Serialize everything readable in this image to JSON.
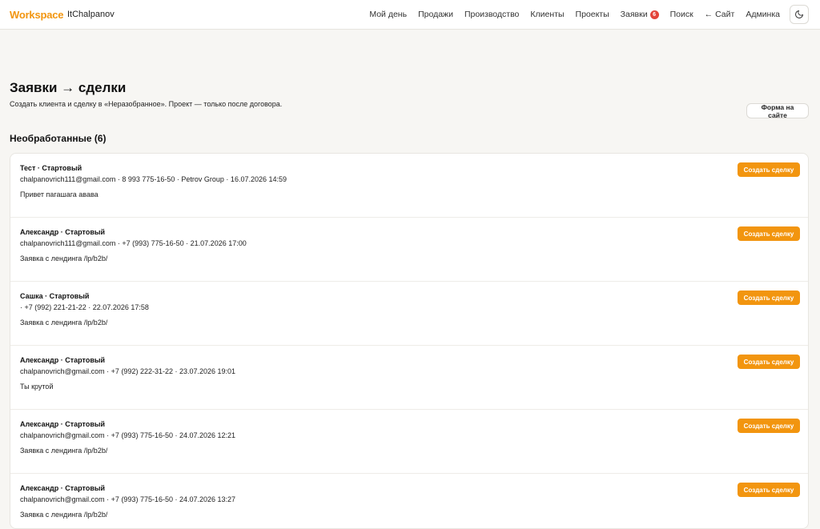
{
  "header": {
    "brand": "Workspace",
    "user": "ItChalpanov",
    "nav": [
      {
        "label": "Мой день"
      },
      {
        "label": "Продажи"
      },
      {
        "label": "Производство"
      },
      {
        "label": "Клиенты"
      },
      {
        "label": "Проекты"
      },
      {
        "label": "Заявки",
        "badge": "6"
      },
      {
        "label": "Поиск"
      },
      {
        "label": "← Сайт"
      },
      {
        "label": "Админка"
      }
    ],
    "theme_icon": "moon-icon"
  },
  "page": {
    "title": "Заявки → сделки",
    "subtitle": "Создать клиента и сделку в «Неразобранное». Проект — только после договора.",
    "form_button": "Форма на сайте",
    "section_title": "Необработанные (6)"
  },
  "requests": [
    {
      "title": "Тест · Стартовый",
      "meta": "chalpanovrich111@gmail.com · 8 993 775-16-50 · Petrov Group · 16.07.2026 14:59",
      "message": "Привет пагашага авава",
      "button": "Создать сделку"
    },
    {
      "title": "Александр · Стартовый",
      "meta": "chalpanovrich111@gmail.com · +7 (993) 775-16-50 · 21.07.2026 17:00",
      "message": "Заявка с лендинга /lp/b2b/",
      "button": "Создать сделку"
    },
    {
      "title": "Сашка · Стартовый",
      "meta": " · +7 (992) 221-21-22 · 22.07.2026 17:58",
      "message": "Заявка с лендинга /lp/b2b/",
      "button": "Создать сделку"
    },
    {
      "title": "Александр · Стартовый",
      "meta": "chalpanovrich@gmail.com · +7 (992) 222-31-22 · 23.07.2026 19:01",
      "message": "Ты крутой",
      "button": "Создать сделку"
    },
    {
      "title": "Александр · Стартовый",
      "meta": "chalpanovrich@gmail.com · +7 (993) 775-16-50 · 24.07.2026 12:21",
      "message": "Заявка с лендинга /lp/b2b/",
      "button": "Создать сделку"
    },
    {
      "title": "Александр · Стартовый",
      "meta": "chalpanovrich@gmail.com · +7 (993) 775-16-50 · 24.07.2026 13:27",
      "message": "Заявка с лендинга /lp/b2b/",
      "button": "Создать сделку"
    }
  ],
  "colors": {
    "accent": "#f2950f",
    "badge": "#e3443a",
    "background": "#f7f6f3"
  }
}
